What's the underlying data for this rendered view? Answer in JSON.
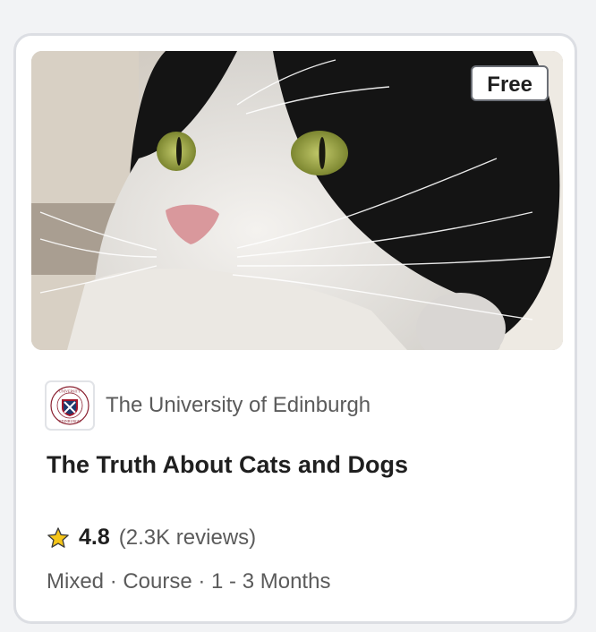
{
  "card": {
    "badge": "Free",
    "image_alt": "Black and white cat close-up",
    "partner": {
      "name": "The University of Edinburgh",
      "logo_icon": "university-of-edinburgh-crest-icon",
      "logo_text_top": "UNIVERSITY",
      "logo_text_bottom": "EDINBURGH"
    },
    "title": "The Truth About Cats and Dogs",
    "rating": {
      "icon": "star-icon",
      "value": "4.8",
      "reviews": "(2.3K reviews)"
    },
    "meta": "Mixed · Course · 1 - 3 Months"
  },
  "colors": {
    "star": "#f5c518",
    "badge_border": "#6b6f76",
    "text_muted": "#5b5b5b",
    "text_primary": "#1f1f1f",
    "crest_red": "#a3162b",
    "crest_blue": "#1e3a6e"
  }
}
